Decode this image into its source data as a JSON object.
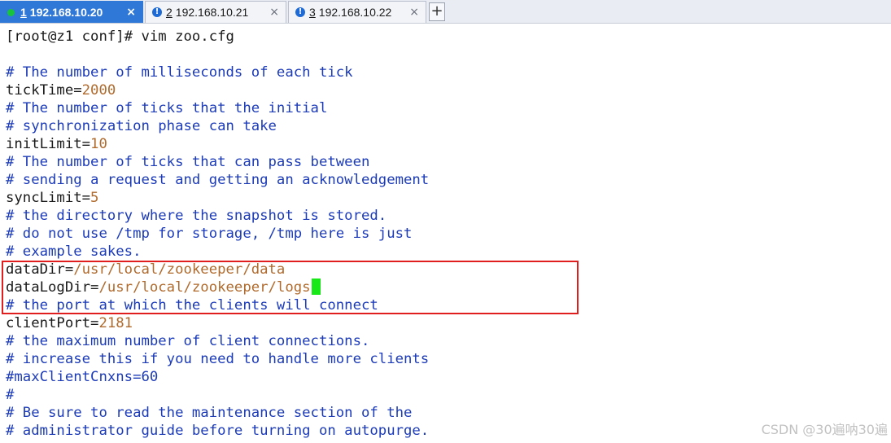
{
  "tabs": [
    {
      "number": "1",
      "title": "192.168.10.20",
      "active": true,
      "status_icon": "green-dot-icon"
    },
    {
      "number": "2",
      "title": "192.168.10.21",
      "active": false,
      "status_icon": "warning-icon"
    },
    {
      "number": "3",
      "title": "192.168.10.22",
      "active": false,
      "status_icon": "warning-icon"
    }
  ],
  "tab_close_glyph": "×",
  "tab_warning_glyph": "!",
  "new_tab_glyph": "+",
  "terminal": {
    "prompt_line": "[root@z1 conf]# vim zoo.cfg",
    "lines": [
      {
        "text": "# The number of milliseconds of each tick"
      },
      {
        "key": "tickTime=",
        "value": "2000"
      },
      {
        "text": "# The number of ticks that the initial"
      },
      {
        "text": "# synchronization phase can take"
      },
      {
        "key": "initLimit=",
        "value": "10"
      },
      {
        "text": "# The number of ticks that can pass between"
      },
      {
        "text": "# sending a request and getting an acknowledgement"
      },
      {
        "key": "syncLimit=",
        "value": "5"
      },
      {
        "text": "# the directory where the snapshot is stored."
      },
      {
        "text": "# do not use /tmp for storage, /tmp here is just"
      },
      {
        "text": "# example sakes."
      },
      {
        "key": "dataDir=",
        "value": "/usr/local/zookeeper/data"
      },
      {
        "key": "dataLogDir=",
        "value": "/usr/local/zookeeper/logs"
      },
      {
        "text": "# the port at which the clients will connect"
      },
      {
        "key": "clientPort=",
        "value": "2181"
      },
      {
        "text": "# the maximum number of client connections."
      },
      {
        "text": "# increase this if you need to handle more clients"
      },
      {
        "text": "#maxClientCnxns=60"
      },
      {
        "text": "#"
      },
      {
        "text": "# Be sure to read the maintenance section of the"
      },
      {
        "text": "# administrator guide before turning on autopurge."
      }
    ]
  },
  "colors": {
    "comment": "#1c3bb8",
    "value": "#b06a2c",
    "cursor": "#18e818",
    "highlight_border": "#e01e1e",
    "active_tab": "#2f78d7"
  },
  "watermark": "CSDN @30遍呐30遍"
}
